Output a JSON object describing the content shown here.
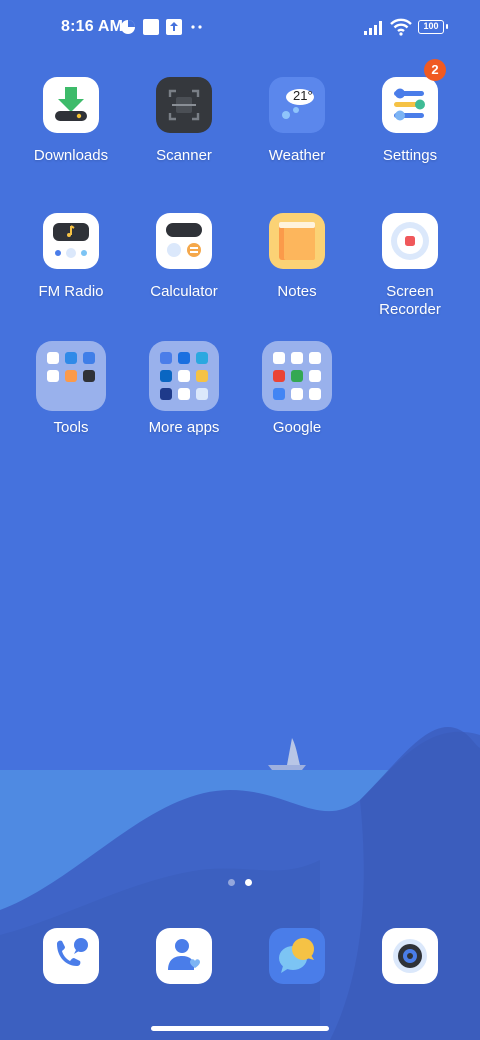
{
  "status_bar": {
    "time": "8:16 AM",
    "battery": "100"
  },
  "apps": {
    "downloads": "Downloads",
    "scanner": "Scanner",
    "weather": "Weather",
    "weather_temp": "21°",
    "settings": "Settings",
    "settings_badge": "2",
    "fm_radio": "FM Radio",
    "calculator": "Calculator",
    "notes": "Notes",
    "screen_recorder": "Screen Recorder"
  },
  "folders": {
    "tools": "Tools",
    "more_apps": "More apps",
    "google": "Google"
  },
  "page_indicator": {
    "pages": 2,
    "current": 2
  },
  "dock": [
    "phone-icon",
    "contacts-icon",
    "messaging-icon",
    "camera-icon"
  ],
  "colors": {
    "wallpaper": "#4572dd",
    "badge": "#f05a22"
  }
}
